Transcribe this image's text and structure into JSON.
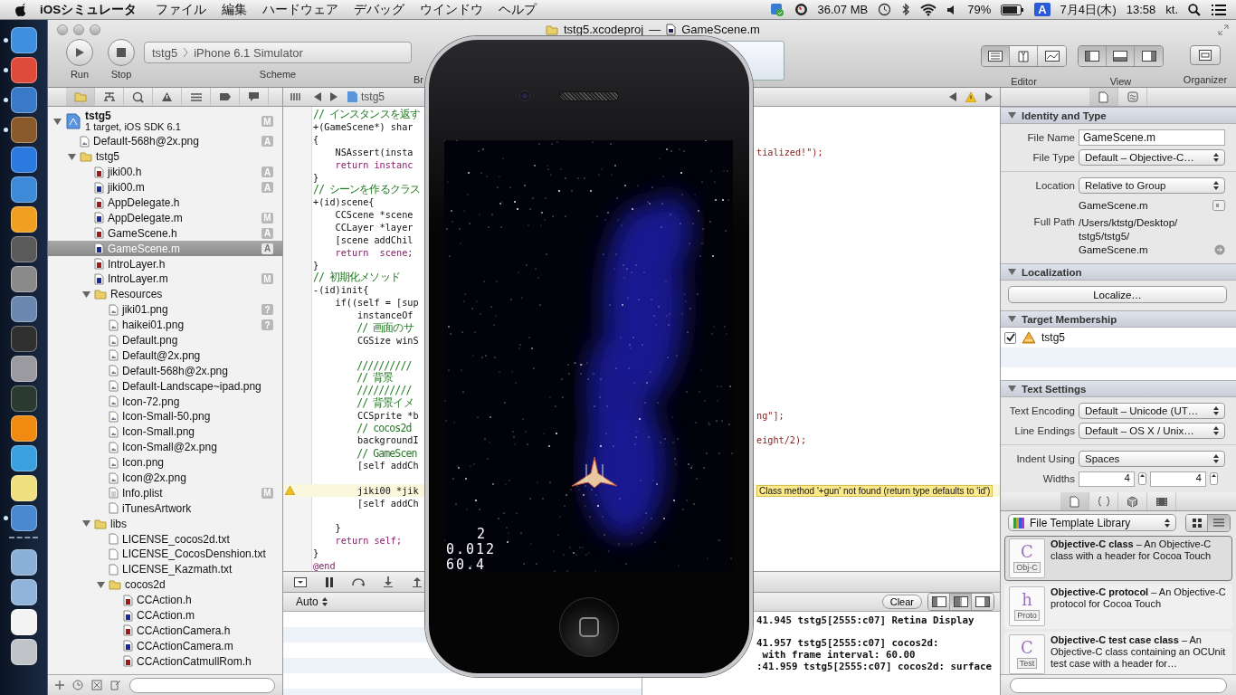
{
  "menubar": {
    "app": "iOSシミュレータ",
    "menus": [
      "ファイル",
      "編集",
      "ハードウェア",
      "デバッグ",
      "ウインドウ",
      "ヘルプ"
    ],
    "status": [
      {
        "kind": "sync"
      },
      {
        "kind": "gauge"
      },
      {
        "kind": "memory",
        "text": "36.07 MB"
      },
      {
        "kind": "clock"
      },
      {
        "kind": "bluetooth"
      },
      {
        "kind": "wifi"
      },
      {
        "kind": "volume"
      },
      {
        "kind": "battery-level",
        "text": "79%"
      },
      {
        "kind": "battery"
      },
      {
        "kind": "input",
        "text": "A"
      },
      {
        "kind": "date",
        "text": "7月4日(木)"
      },
      {
        "kind": "time",
        "text": "13:58"
      },
      {
        "kind": "user",
        "text": "kt."
      },
      {
        "kind": "search"
      },
      {
        "kind": "list"
      }
    ]
  },
  "dock": [
    {
      "kind": "app",
      "color": "#3f8fe0",
      "running": true
    },
    {
      "kind": "app",
      "color": "#e04a3a",
      "running": true
    },
    {
      "kind": "app",
      "color": "#3a78c8",
      "running": true
    },
    {
      "kind": "app",
      "color": "#8a5a2a",
      "running": true
    },
    {
      "kind": "app",
      "color": "#2a7ae0",
      "running": false
    },
    {
      "kind": "app",
      "color": "#3c8ad8",
      "running": false
    },
    {
      "kind": "app",
      "color": "#f0a020",
      "running": false
    },
    {
      "kind": "app",
      "color": "#5a5a5a",
      "running": false
    },
    {
      "kind": "app",
      "color": "#8a8a8a",
      "running": false
    },
    {
      "kind": "app",
      "color": "#6a88b0",
      "running": false
    },
    {
      "kind": "app",
      "color": "#303030",
      "running": false
    },
    {
      "kind": "app",
      "color": "#9a9aa0",
      "running": false
    },
    {
      "kind": "app",
      "color": "#2a3a30",
      "running": false
    },
    {
      "kind": "app",
      "color": "#f08a10",
      "running": false
    },
    {
      "kind": "app",
      "color": "#3aa0e0",
      "running": false
    },
    {
      "kind": "app",
      "color": "#f0e080",
      "running": false
    },
    {
      "kind": "app",
      "color": "#4a88d0",
      "running": true
    },
    {
      "kind": "separator"
    },
    {
      "kind": "app",
      "color": "#8ab0d8",
      "running": false
    },
    {
      "kind": "app",
      "color": "#90b4da",
      "running": false
    },
    {
      "kind": "app",
      "color": "#f4f4f4",
      "running": false
    },
    {
      "kind": "app",
      "color": "#c0c4c8",
      "running": false
    }
  ],
  "window": {
    "title_project": "tstg5.xcodeproj",
    "title_sep": "—",
    "title_file": "GameScene.m"
  },
  "toolbar": {
    "run": "Run",
    "stop": "Stop",
    "scheme_target": "tstg5",
    "scheme_device": "iPhone 6.1 Simulator",
    "scheme_label": "Scheme",
    "breakpoints_label": "Br",
    "editor_label": "Editor",
    "view_label": "View",
    "organizer_label": "Organizer",
    "editor_modes": [
      {
        "kind": "standard",
        "selected": true
      },
      {
        "kind": "assistant",
        "selected": false
      },
      {
        "kind": "version",
        "selected": false
      }
    ],
    "views": [
      {
        "kind": "left",
        "selected": true
      },
      {
        "kind": "bottom",
        "selected": true
      },
      {
        "kind": "right",
        "selected": true
      }
    ]
  },
  "navigator": {
    "tabs": [
      {
        "kind": "folder",
        "selected": true
      },
      {
        "kind": "hierarchy",
        "selected": false
      },
      {
        "kind": "search",
        "selected": false
      },
      {
        "kind": "warning",
        "selected": false
      },
      {
        "kind": "list",
        "selected": false
      },
      {
        "kind": "tag",
        "selected": false
      },
      {
        "kind": "bubble",
        "selected": false
      }
    ],
    "project": {
      "name": "tstg5",
      "subtitle": "1 target, iOS SDK 6.1",
      "badge": "M",
      "expanded": true,
      "selected": false,
      "children": [
        {
          "name": "Default-568h@2x.png",
          "kind": "image",
          "badge": "A",
          "selected": false
        },
        {
          "name": "tstg5",
          "kind": "folder",
          "expanded": true,
          "selected": false,
          "children": [
            {
              "name": "jiki00.h",
              "kind": "h",
              "badge": "A",
              "selected": false
            },
            {
              "name": "jiki00.m",
              "kind": "m",
              "badge": "A",
              "selected": false
            },
            {
              "name": "AppDelegate.h",
              "kind": "h",
              "selected": false
            },
            {
              "name": "AppDelegate.m",
              "kind": "m",
              "badge": "M",
              "selected": false
            },
            {
              "name": "GameScene.h",
              "kind": "h",
              "badge": "A",
              "selected": false
            },
            {
              "name": "GameScene.m",
              "kind": "m",
              "badge": "A",
              "selected": true
            },
            {
              "name": "IntroLayer.h",
              "kind": "h",
              "selected": false
            },
            {
              "name": "IntroLayer.m",
              "kind": "m",
              "badge": "M",
              "selected": false
            },
            {
              "name": "Resources",
              "kind": "folder",
              "expanded": true,
              "selected": false,
              "children": [
                {
                  "name": "jiki01.png",
                  "kind": "image",
                  "badge": "?",
                  "selected": false
                },
                {
                  "name": "haikei01.png",
                  "kind": "image",
                  "badge": "?",
                  "selected": false
                },
                {
                  "name": "Default.png",
                  "kind": "image",
                  "selected": false
                },
                {
                  "name": "Default@2x.png",
                  "kind": "image",
                  "selected": false
                },
                {
                  "name": "Default-568h@2x.png",
                  "kind": "image",
                  "selected": false
                },
                {
                  "name": "Default-Landscape~ipad.png",
                  "kind": "image",
                  "selected": false
                },
                {
                  "name": "Icon-72.png",
                  "kind": "image",
                  "selected": false
                },
                {
                  "name": "Icon-Small-50.png",
                  "kind": "image",
                  "selected": false
                },
                {
                  "name": "Icon-Small.png",
                  "kind": "image",
                  "selected": false
                },
                {
                  "name": "Icon-Small@2x.png",
                  "kind": "image",
                  "selected": false
                },
                {
                  "name": "Icon.png",
                  "kind": "image",
                  "selected": false
                },
                {
                  "name": "Icon@2x.png",
                  "kind": "image",
                  "selected": false
                },
                {
                  "name": "Info.plist",
                  "kind": "plist",
                  "badge": "M",
                  "selected": false
                },
                {
                  "name": "iTunesArtwork",
                  "kind": "file",
                  "selected": false
                }
              ]
            },
            {
              "name": "libs",
              "kind": "folder",
              "expanded": true,
              "selected": false,
              "children": [
                {
                  "name": "LICENSE_cocos2d.txt",
                  "kind": "file",
                  "selected": false
                },
                {
                  "name": "LICENSE_CocosDenshion.txt",
                  "kind": "file",
                  "selected": false
                },
                {
                  "name": "LICENSE_Kazmath.txt",
                  "kind": "file",
                  "selected": false
                },
                {
                  "name": "cocos2d",
                  "kind": "folder",
                  "expanded": true,
                  "selected": false,
                  "children": [
                    {
                      "name": "CCAction.h",
                      "kind": "h",
                      "selected": false
                    },
                    {
                      "name": "CCAction.m",
                      "kind": "m",
                      "selected": false
                    },
                    {
                      "name": "CCActionCamera.h",
                      "kind": "h",
                      "selected": false
                    },
                    {
                      "name": "CCActionCamera.m",
                      "kind": "m",
                      "selected": false
                    },
                    {
                      "name": "CCActionCatmullRom.h",
                      "kind": "h",
                      "selected": false
                    }
                  ]
                }
              ]
            }
          ]
        }
      ]
    }
  },
  "editor": {
    "crumb": "tstg5",
    "lines": [
      {
        "kind": "comment",
        "text": "// インスタンスを返す"
      },
      {
        "kind": "code",
        "text": "+(GameScene*) shar"
      },
      {
        "kind": "code",
        "text": "{"
      },
      {
        "kind": "code",
        "text": "    NSAssert(insta",
        "right": "tialized!\");"
      },
      {
        "kind": "keyword",
        "text": "    return instanc"
      },
      {
        "kind": "code",
        "text": "}"
      },
      {
        "kind": "comment",
        "text": "// シーンを作るクラス"
      },
      {
        "kind": "code",
        "text": "+(id)scene{"
      },
      {
        "kind": "code",
        "text": "    CCScene *scene"
      },
      {
        "kind": "code",
        "text": "    CCLayer *layer"
      },
      {
        "kind": "code",
        "text": "    [scene addChil"
      },
      {
        "kind": "keyword",
        "text": "    return  scene;"
      },
      {
        "kind": "code",
        "text": "}"
      },
      {
        "kind": "comment",
        "text": "// 初期化メソッド"
      },
      {
        "kind": "code",
        "text": "-(id)init{"
      },
      {
        "kind": "code",
        "text": "    if((self = [sup"
      },
      {
        "kind": "code",
        "text": "        instanceOf"
      },
      {
        "kind": "comment",
        "text": "        // 画面のサ"
      },
      {
        "kind": "code",
        "text": "        CGSize winS"
      },
      {
        "kind": "blank"
      },
      {
        "kind": "comment",
        "text": "        //////////"
      },
      {
        "kind": "comment",
        "text": "        // 背景"
      },
      {
        "kind": "comment",
        "text": "        //////////"
      },
      {
        "kind": "comment",
        "text": "        // 背景イメ"
      },
      {
        "kind": "code",
        "text": "        CCSprite *b",
        "right": "ng\"];"
      },
      {
        "kind": "comment",
        "text": "        // cocos2d"
      },
      {
        "kind": "code",
        "text": "        backgroundI",
        "right": "eight/2);"
      },
      {
        "kind": "comment",
        "text": "        // GameScen"
      },
      {
        "kind": "code",
        "text": "        [self addCh"
      },
      {
        "kind": "blank"
      },
      {
        "kind": "code",
        "text": "        jiki00 *jik",
        "warning": "Class method '+gun' not found (return type defaults to 'id')"
      },
      {
        "kind": "code",
        "text": "        [self addCh"
      },
      {
        "kind": "blank"
      },
      {
        "kind": "code",
        "text": "    }"
      },
      {
        "kind": "keyword",
        "text": "    return self;"
      },
      {
        "kind": "code",
        "text": "}"
      },
      {
        "kind": "keyword",
        "text": "@end"
      }
    ]
  },
  "debug": {
    "scope": "Auto",
    "clear": "Clear",
    "panes": [
      {
        "kind": "left",
        "selected": false
      },
      {
        "kind": "both",
        "selected": true
      },
      {
        "kind": "right",
        "selected": false
      }
    ],
    "console": [
      {
        "kind": "text",
        "text": "41.945 tstg5[2555:c07] Retina Display"
      },
      {
        "kind": "blank"
      },
      {
        "kind": "text",
        "text": "41.957 tstg5[2555:c07] cocos2d:"
      },
      {
        "kind": "text",
        "text": " with frame interval: 60.00"
      },
      {
        "kind": "text",
        "text": ":41.959 tstg5[2555:c07] cocos2d: surface"
      }
    ]
  },
  "simulator": {
    "hud": [
      "2",
      "0.012",
      "60.4"
    ]
  },
  "inspector": {
    "tabs": [
      {
        "kind": "file",
        "selected": true
      },
      {
        "kind": "help",
        "selected": false
      }
    ],
    "sections": [
      {
        "title": "Identity and Type",
        "expanded": true,
        "rows": [
          {
            "kind": "field",
            "label": "File Name",
            "value": "GameScene.m"
          },
          {
            "kind": "popup",
            "label": "File Type",
            "value": "Default – Objective-C…"
          },
          {
            "kind": "divider"
          },
          {
            "kind": "popup",
            "label": "Location",
            "value": "Relative to Group"
          },
          {
            "kind": "path",
            "value": "GameScene.m"
          },
          {
            "kind": "fullpath",
            "label": "Full Path",
            "lines": [
              "/Users/ktstg/Desktop/",
              "tstg5/tstg5/",
              "GameScene.m"
            ]
          }
        ]
      },
      {
        "title": "Localization",
        "expanded": true,
        "rows": [
          {
            "kind": "button",
            "value": "Localize…"
          }
        ]
      },
      {
        "title": "Target Membership",
        "expanded": true,
        "rows": [
          {
            "kind": "check",
            "checked": true,
            "value": "tstg5"
          }
        ]
      },
      {
        "title": "Text Settings",
        "expanded": true,
        "rows": [
          {
            "kind": "popup",
            "label": "Text Encoding",
            "value": "Default – Unicode (UT…"
          },
          {
            "kind": "popup",
            "label": "Line Endings",
            "value": "Default – OS X / Unix…"
          },
          {
            "kind": "divider"
          },
          {
            "kind": "popup",
            "label": "Indent Using",
            "value": "Spaces"
          },
          {
            "kind": "steppers",
            "label": "Widths",
            "values": [
              "4",
              "4"
            ]
          }
        ]
      }
    ]
  },
  "library": {
    "tabs": [
      {
        "kind": "file",
        "selected": true
      },
      {
        "kind": "braces",
        "selected": false
      },
      {
        "kind": "cube",
        "selected": false
      },
      {
        "kind": "film",
        "selected": false
      }
    ],
    "source": "File Template Library",
    "views": [
      {
        "kind": "grid",
        "selected": false
      },
      {
        "kind": "list",
        "selected": true
      }
    ],
    "items": [
      {
        "glyph": "C",
        "badge": "Obj-C",
        "text": "**Objective-C class** – An Objective-C class with a header for Cocoa Touch",
        "selected": true
      },
      {
        "glyph": "h",
        "badge": "Proto",
        "text": "**Objective-C protocol** – An Objective-C protocol for Cocoa Touch",
        "selected": false
      },
      {
        "glyph": "C",
        "badge": "Test",
        "text": "**Objective-C test case class** – An Objective-C class containing an OCUnit test case with a header for…",
        "selected": false
      }
    ]
  }
}
